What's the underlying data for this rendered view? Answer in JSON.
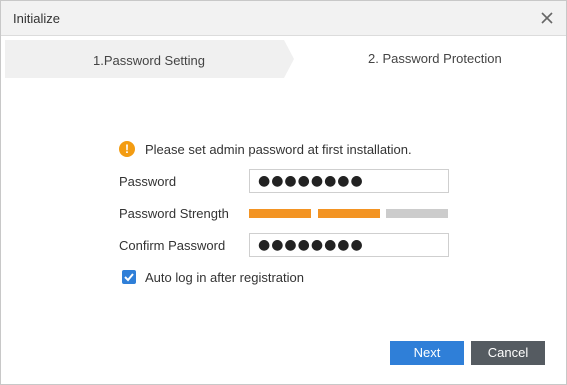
{
  "window": {
    "title": "Initialize",
    "close_icon": "close-icon"
  },
  "steps": {
    "step1_label": "1.Password Setting",
    "step2_label": "2. Password Protection"
  },
  "form": {
    "info_icon": "warning-icon",
    "info_text": "Please set admin password at first installation.",
    "password_label": "Password",
    "password_value": "●●●●●●●●",
    "strength_label": "Password Strength",
    "strength_level": "2/3",
    "confirm_label": "Confirm Password",
    "confirm_value": "●●●●●●●●",
    "auto_login_label": "Auto log in after registration",
    "auto_login_checked": true
  },
  "buttons": {
    "next_label": "Next",
    "cancel_label": "Cancel"
  },
  "colors": {
    "accent": "#2f7fd8",
    "strength_on": "#f39423",
    "strength_off": "#cccccc",
    "cancel_bg": "#555b61",
    "warning": "#f39c12"
  }
}
